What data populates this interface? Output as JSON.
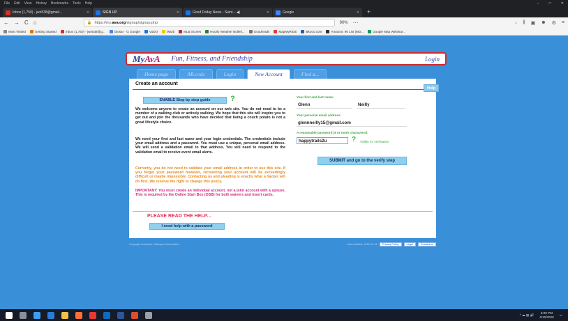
{
  "menu": [
    "File",
    "Edit",
    "View",
    "History",
    "Bookmarks",
    "Tools",
    "Help"
  ],
  "window_controls": [
    "−",
    "□",
    "✕"
  ],
  "tabs": [
    {
      "label": "Inbox (1,750) - jwn538@gmail...",
      "color": "#d93025",
      "active": false
    },
    {
      "label": "SIGN UP",
      "color": "#1a73e8",
      "active": true
    },
    {
      "label": "Good Friday News - Saint... ◀)",
      "color": "#1a73e8",
      "active": false
    },
    {
      "label": "Google",
      "color": "#4285f4",
      "active": false
    }
  ],
  "nav": {
    "back": "←",
    "forward": "→",
    "reload": "C",
    "home": "⌂",
    "url_prefix": "https://my.",
    "url_domain": "ava.org",
    "url_suffix": "/signup/signup.php",
    "zoom": "90%",
    "more": "···",
    "right_icons": [
      "↓",
      "⫼",
      "▣",
      "☻",
      "⚙",
      "≡"
    ]
  },
  "bookmarks": [
    {
      "label": "Most Visited",
      "color": "#888"
    },
    {
      "label": "Getting Started",
      "color": "#e8710a"
    },
    {
      "label": "Inbox (1,750) - jwn538@g...",
      "color": "#d93025"
    },
    {
      "label": "Glosar · G Google",
      "color": "#4285f4"
    },
    {
      "label": "VoDO",
      "color": "#1a73e8"
    },
    {
      "label": "IMDb",
      "color": "#f5c518"
    },
    {
      "label": "MLB Scores",
      "color": "#c62828"
    },
    {
      "label": "Hourly Weather Bulleti...",
      "color": "#2e7d32"
    },
    {
      "label": "Goodreads",
      "color": "#8d6e63"
    },
    {
      "label": "MapMyRIDE",
      "color": "#e53935"
    },
    {
      "label": "Bkooo.com",
      "color": "#1565c0"
    },
    {
      "label": "Amazon: 90 List (MD...",
      "color": "#333"
    },
    {
      "label": "Google Map Webinar...",
      "color": "#0f9d58"
    }
  ],
  "site": {
    "logo_my": "My",
    "logo_ava": "AvA",
    "tagline": "Fun, Fitness, and Friendship",
    "login": "Login",
    "tabs": [
      "Home page",
      "AR.code",
      "Login",
      "New Account",
      "Find a..."
    ]
  },
  "form": {
    "title": "Create an account",
    "help": "Help",
    "enable_btn": "ENABLE Step by step guide",
    "q": "?",
    "para1": "We welcome anyone to create an account on our web site. You do not need to be a member of a walking club or actively walking. We hope that this site will inspire you to get out and join the thousands who have decided that being a couch potato is not a great lifestyle choice.",
    "para2": "We need your first and last name and your login credentials. The credentials include your email address and a password. You must use a unique, personal email address. We will send a validation email to that address. You will need to respond to the validation email to receive event email alerts.",
    "para3": "Currently, you do not need to validate your email address in order to use this site. If you forget your password however, recovering your account will be exceedingly difficult or maybe impossible. Contacting us and pleading is exactly what a hacker will do first. We reserve the right to change this policy.",
    "para4": "IMPORTANT: You must create an individual account, not a joint account with a spouse. This is required by the Online Start Box (OSB) for both waivers and insert cards.",
    "read_help": "PLEASE READ THE HELP...",
    "pw_help_btn": "I need help with a password",
    "label_name": "Your first and last name:",
    "first_name": "Glenn",
    "last_name": "Neilly",
    "label_email": "Your personal email address:",
    "email": "glennneilly15@gmail.com",
    "label_password": "A reasonable password (8 or more characters):",
    "password": "happytrails2u",
    "pw_note": "Visible for verification",
    "submit": "SUBMIT and go to the verify step"
  },
  "footer": {
    "left": "Copyright American Volkssport Association",
    "right_text": "Last modified: 2019-04-01",
    "buttons": [
      "Privacy Policy",
      "Legal",
      "Contact us"
    ]
  },
  "taskbar": {
    "icons": [
      {
        "name": "windows-start-icon",
        "color": "#ffffff"
      },
      {
        "name": "task-view-icon",
        "color": "#8a8f98"
      },
      {
        "name": "edge-icon",
        "color": "#3aa0f3"
      },
      {
        "name": "store-icon",
        "color": "#2b7cd3"
      },
      {
        "name": "file-explorer-icon",
        "color": "#f2c04a"
      },
      {
        "name": "firefox-icon",
        "color": "#ff7139"
      },
      {
        "name": "app-icon",
        "color": "#e53935"
      },
      {
        "name": "outlook-icon",
        "color": "#0f6cbd"
      },
      {
        "name": "word-icon",
        "color": "#2b579a"
      },
      {
        "name": "photos-icon",
        "color": "#d94f30"
      },
      {
        "name": "pen-icon",
        "color": "#9aa0a6"
      }
    ],
    "time": "3:09 PM",
    "date": "4/10/2020"
  }
}
